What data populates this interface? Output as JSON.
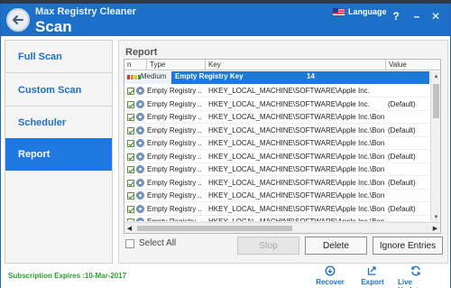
{
  "titlebar": {
    "app_name": "Max Registry Cleaner",
    "title": "Scan",
    "language_label": "Language",
    "help_label": "?",
    "minimize_label": "–",
    "close_label": "✕"
  },
  "sidebar": {
    "items": [
      {
        "label": "Full Scan",
        "active": false
      },
      {
        "label": "Custom Scan",
        "active": false
      },
      {
        "label": "Scheduler",
        "active": false
      },
      {
        "label": "Report",
        "active": true
      }
    ]
  },
  "report": {
    "title": "Report",
    "columns": [
      "n",
      "Type",
      "Key",
      "Value"
    ],
    "group": {
      "severity": "Medium",
      "name": "Empty Registry Key",
      "count": "14"
    },
    "rows": [
      {
        "type": "Empty Registry ...",
        "key": "HKEY_LOCAL_MACHINE\\SOFTWARE\\Apple Inc.",
        "value": ""
      },
      {
        "type": "Empty Registry ...",
        "key": "HKEY_LOCAL_MACHINE\\SOFTWARE\\Apple Inc.",
        "value": "(Default)"
      },
      {
        "type": "Empty Registry ...",
        "key": "HKEY_LOCAL_MACHINE\\SOFTWARE\\Apple Inc.\\Bonj",
        "value": ""
      },
      {
        "type": "Empty Registry ...",
        "key": "HKEY_LOCAL_MACHINE\\SOFTWARE\\Apple Inc.\\Bonj",
        "value": "(Default)"
      },
      {
        "type": "Empty Registry ...",
        "key": "HKEY_LOCAL_MACHINE\\SOFTWARE\\Apple Inc.\\Bonj",
        "value": ""
      },
      {
        "type": "Empty Registry ...",
        "key": "HKEY_LOCAL_MACHINE\\SOFTWARE\\Apple Inc.\\Bonj",
        "value": "(Default)"
      },
      {
        "type": "Empty Registry ...",
        "key": "HKEY_LOCAL_MACHINE\\SOFTWARE\\Apple Inc.\\Bonj",
        "value": ""
      },
      {
        "type": "Empty Registry ...",
        "key": "HKEY_LOCAL_MACHINE\\SOFTWARE\\Apple Inc.\\Bonj",
        "value": "(Default)"
      },
      {
        "type": "Empty Registry ...",
        "key": "HKEY_LOCAL_MACHINE\\SOFTWARE\\Apple Inc.\\Bonj",
        "value": ""
      },
      {
        "type": "Empty Registry ...",
        "key": "HKEY_LOCAL_MACHINE\\SOFTWARE\\Apple Inc.\\Bonj",
        "value": "(Default)"
      },
      {
        "type": "Empty Registry ...",
        "key": "HKEY_LOCAL_MACHINE\\SOFTWARE\\Apple Inc.\\Bonj",
        "value": ""
      }
    ],
    "select_all_label": "Select All",
    "buttons": {
      "stop": "Stop",
      "delete": "Delete",
      "ignore": "Ignore Entries"
    }
  },
  "footer": {
    "subscription": "Subscription Expires :10-Mar-2017",
    "recover": "Recover",
    "export": "Export",
    "live_update": "Live Update"
  },
  "colors": {
    "titlebar": "#1e6fc8",
    "active_nav": "#1e78e0",
    "selection": "#1c7ad6",
    "subscription_text": "#2f9b2f"
  }
}
